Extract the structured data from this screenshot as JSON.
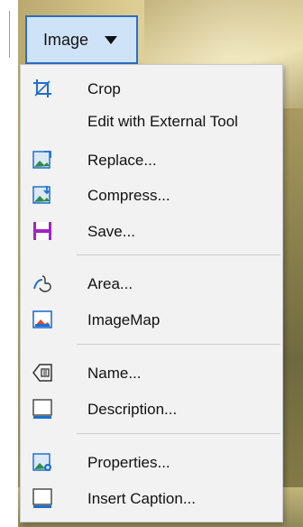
{
  "dropdown": {
    "label": "Image"
  },
  "menu": {
    "items": [
      {
        "label": "Crop",
        "icon": "crop-icon"
      },
      {
        "label": "Edit with External Tool",
        "icon": ""
      },
      {
        "label": "Replace...",
        "icon": "replace-image-icon"
      },
      {
        "label": "Compress...",
        "icon": "compress-image-icon"
      },
      {
        "label": "Save...",
        "icon": "save-icon"
      },
      {
        "label": "Area...",
        "icon": "area-icon"
      },
      {
        "label": "ImageMap",
        "icon": "imagemap-icon"
      },
      {
        "label": "Name...",
        "icon": "name-icon"
      },
      {
        "label": "Description...",
        "icon": "description-icon"
      },
      {
        "label": "Properties...",
        "icon": "properties-icon"
      },
      {
        "label": "Insert Caption...",
        "icon": "insert-caption-icon"
      }
    ]
  },
  "colors": {
    "accent": "#2a6fc0",
    "save_icon": "#a024c8",
    "menu_bg": "#f2f2f2"
  }
}
